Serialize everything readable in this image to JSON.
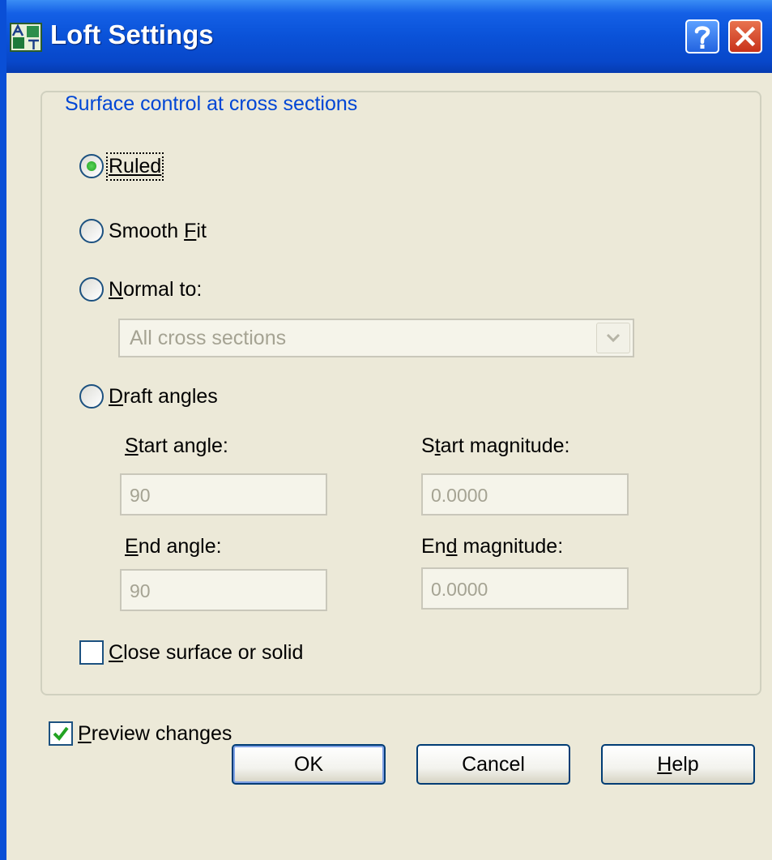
{
  "window": {
    "title": "Loft Settings",
    "app_icon": "autocad-dialog-icon",
    "help_icon": "question-mark-icon",
    "close_icon": "close-x-icon"
  },
  "surface_group": {
    "legend": "Surface control at cross sections",
    "options": {
      "ruled": {
        "label": "Ruled",
        "selected": true
      },
      "smooth_fit": {
        "prefix": "Smooth ",
        "accel": "F",
        "suffix": "it",
        "selected": false
      },
      "normal_to": {
        "accel": "N",
        "suffix": "ormal to:",
        "selected": false
      },
      "draft_angles": {
        "accel": "D",
        "suffix": "raft angles",
        "selected": false
      }
    },
    "normal_to_select": {
      "value": "All cross sections",
      "enabled": false
    },
    "start_angle": {
      "accel": "S",
      "suffix": "tart angle:",
      "value": "90"
    },
    "start_magnitude": {
      "prefix": "S",
      "accel": "t",
      "suffix": "art magnitude:",
      "value": "0.0000"
    },
    "end_angle": {
      "accel": "E",
      "suffix": "nd angle:",
      "value": "90"
    },
    "end_magnitude": {
      "prefix": "En",
      "accel": "d",
      "suffix": " magnitude:",
      "value": "0.0000"
    },
    "close_surface": {
      "accel": "C",
      "suffix": "lose surface or solid",
      "checked": false
    }
  },
  "preview_changes": {
    "accel": "P",
    "suffix": "review changes",
    "checked": true
  },
  "buttons": {
    "ok": "OK",
    "cancel": "Cancel",
    "help": {
      "accel": "H",
      "suffix": "elp"
    }
  },
  "colors": {
    "titlebar": "#0a52d8",
    "legend_text": "#0046d5",
    "radio_selected": "#22a322",
    "dialog_bg": "#ece9d8"
  }
}
